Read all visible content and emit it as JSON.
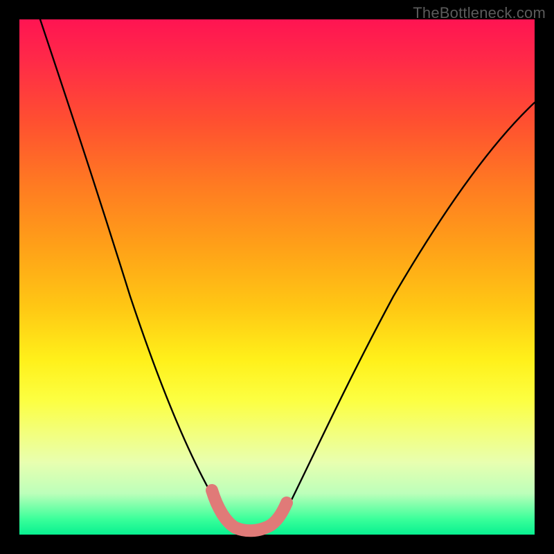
{
  "watermark": {
    "text": "TheBottleneck.com"
  },
  "chart_data": {
    "type": "line",
    "title": "",
    "xlabel": "",
    "ylabel": "",
    "xlim": [
      0,
      100
    ],
    "ylim": [
      0,
      100
    ],
    "grid": false,
    "series": [
      {
        "name": "bottleneck-curve",
        "color": "#000000",
        "x": [
          4,
          8,
          12,
          16,
          20,
          24,
          28,
          32,
          34,
          36,
          38,
          40,
          42,
          44,
          46,
          48,
          52,
          56,
          60,
          64,
          70,
          76,
          82,
          88,
          94,
          100
        ],
        "y": [
          100,
          88,
          76,
          65,
          55,
          45,
          36,
          27,
          22,
          17,
          12,
          7,
          3,
          1,
          0,
          0,
          3,
          9,
          16,
          23,
          33,
          42,
          50,
          57,
          63,
          68
        ]
      },
      {
        "name": "optimal-range-marker",
        "color": "#e07a78",
        "x": [
          38,
          40,
          42,
          44,
          46,
          48,
          50
        ],
        "y": [
          8,
          3,
          1,
          0,
          0,
          1,
          5
        ]
      }
    ],
    "gradient_stops": [
      {
        "pos": 0.0,
        "color": "#ff1452"
      },
      {
        "pos": 0.5,
        "color": "#ffd014"
      },
      {
        "pos": 0.8,
        "color": "#f8ff60"
      },
      {
        "pos": 1.0,
        "color": "#08f090"
      }
    ]
  }
}
